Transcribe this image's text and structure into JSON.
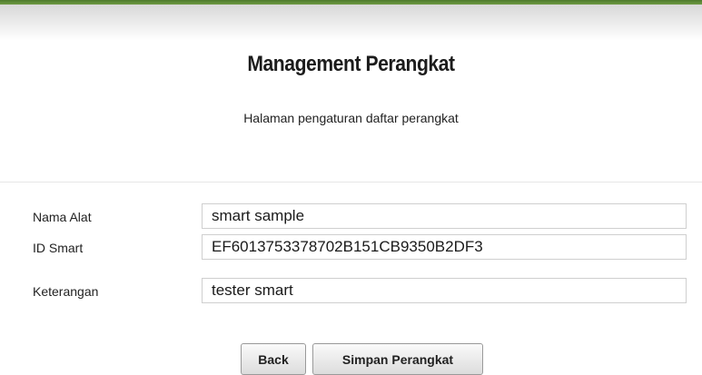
{
  "page": {
    "title": "Management Perangkat",
    "subtitle": "Halaman pengaturan daftar perangkat"
  },
  "form": {
    "fields": [
      {
        "label": "Nama Alat",
        "value": "smart sample"
      },
      {
        "label": "ID Smart",
        "value": "EF6013753378702B151CB9350B2DF3"
      },
      {
        "label": "Keterangan",
        "value": "tester smart"
      }
    ]
  },
  "actions": {
    "back_label": "Back",
    "save_label": "Simpan Perangkat"
  },
  "colors": {
    "topbar": "#5b8a35"
  }
}
